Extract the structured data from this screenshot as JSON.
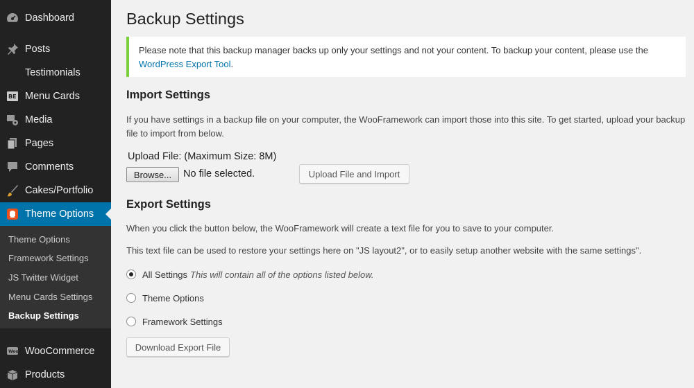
{
  "sidebar": {
    "items": [
      {
        "label": "Dashboard",
        "icon": "dashboard-icon"
      },
      {
        "label": "Posts",
        "icon": "pin-icon"
      },
      {
        "label": "Testimonials",
        "icon": ""
      },
      {
        "label": "Menu Cards",
        "icon": "menu-card-icon"
      },
      {
        "label": "Media",
        "icon": "media-icon"
      },
      {
        "label": "Pages",
        "icon": "pages-icon"
      },
      {
        "label": "Comments",
        "icon": "comment-icon"
      },
      {
        "label": "Cakes/Portfolio",
        "icon": "brush-icon"
      },
      {
        "label": "Theme Options",
        "icon": "theme-options-icon"
      },
      {
        "label": "WooCommerce",
        "icon": "woocommerce-icon"
      },
      {
        "label": "Products",
        "icon": "products-icon"
      }
    ],
    "active_item": "Theme Options",
    "submenu": [
      "Theme Options",
      "Framework Settings",
      "JS Twitter Widget",
      "Menu Cards Settings",
      "Backup Settings"
    ],
    "current_submenu": "Backup Settings"
  },
  "page": {
    "title": "Backup Settings",
    "notice": {
      "text": "Please note that this backup manager backs up only your settings and not your content. To backup your content, please use the",
      "link": "WordPress Export Tool",
      "suffix": "."
    },
    "import": {
      "heading": "Import Settings",
      "description": "If you have settings in a backup file on your computer, the WooFramework can import those into this site. To get started, upload your backup file to import from below.",
      "upload_label": "Upload File: (Maximum Size: 8M)",
      "browse_label": "Browse...",
      "no_file": "No file selected.",
      "submit_label": "Upload File and Import"
    },
    "export": {
      "heading": "Export Settings",
      "description_1": "When you click the button below, the WooFramework will create a text file for you to save to your computer.",
      "description_2": "This text file can be used to restore your settings here on \"JS layout2\", or to easily setup another website with the same settings\".",
      "options": [
        {
          "label": "All Settings",
          "description": "This will contain all of the options listed below.",
          "checked": true
        },
        {
          "label": "Theme Options",
          "description": "",
          "checked": false
        },
        {
          "label": "Framework Settings",
          "description": "",
          "checked": false
        }
      ],
      "download_label": "Download Export File"
    }
  },
  "colors": {
    "sidebar_bg": "#222222",
    "active_bg": "#0073aa",
    "notice_border": "#7ad03a",
    "link": "#0073aa"
  }
}
